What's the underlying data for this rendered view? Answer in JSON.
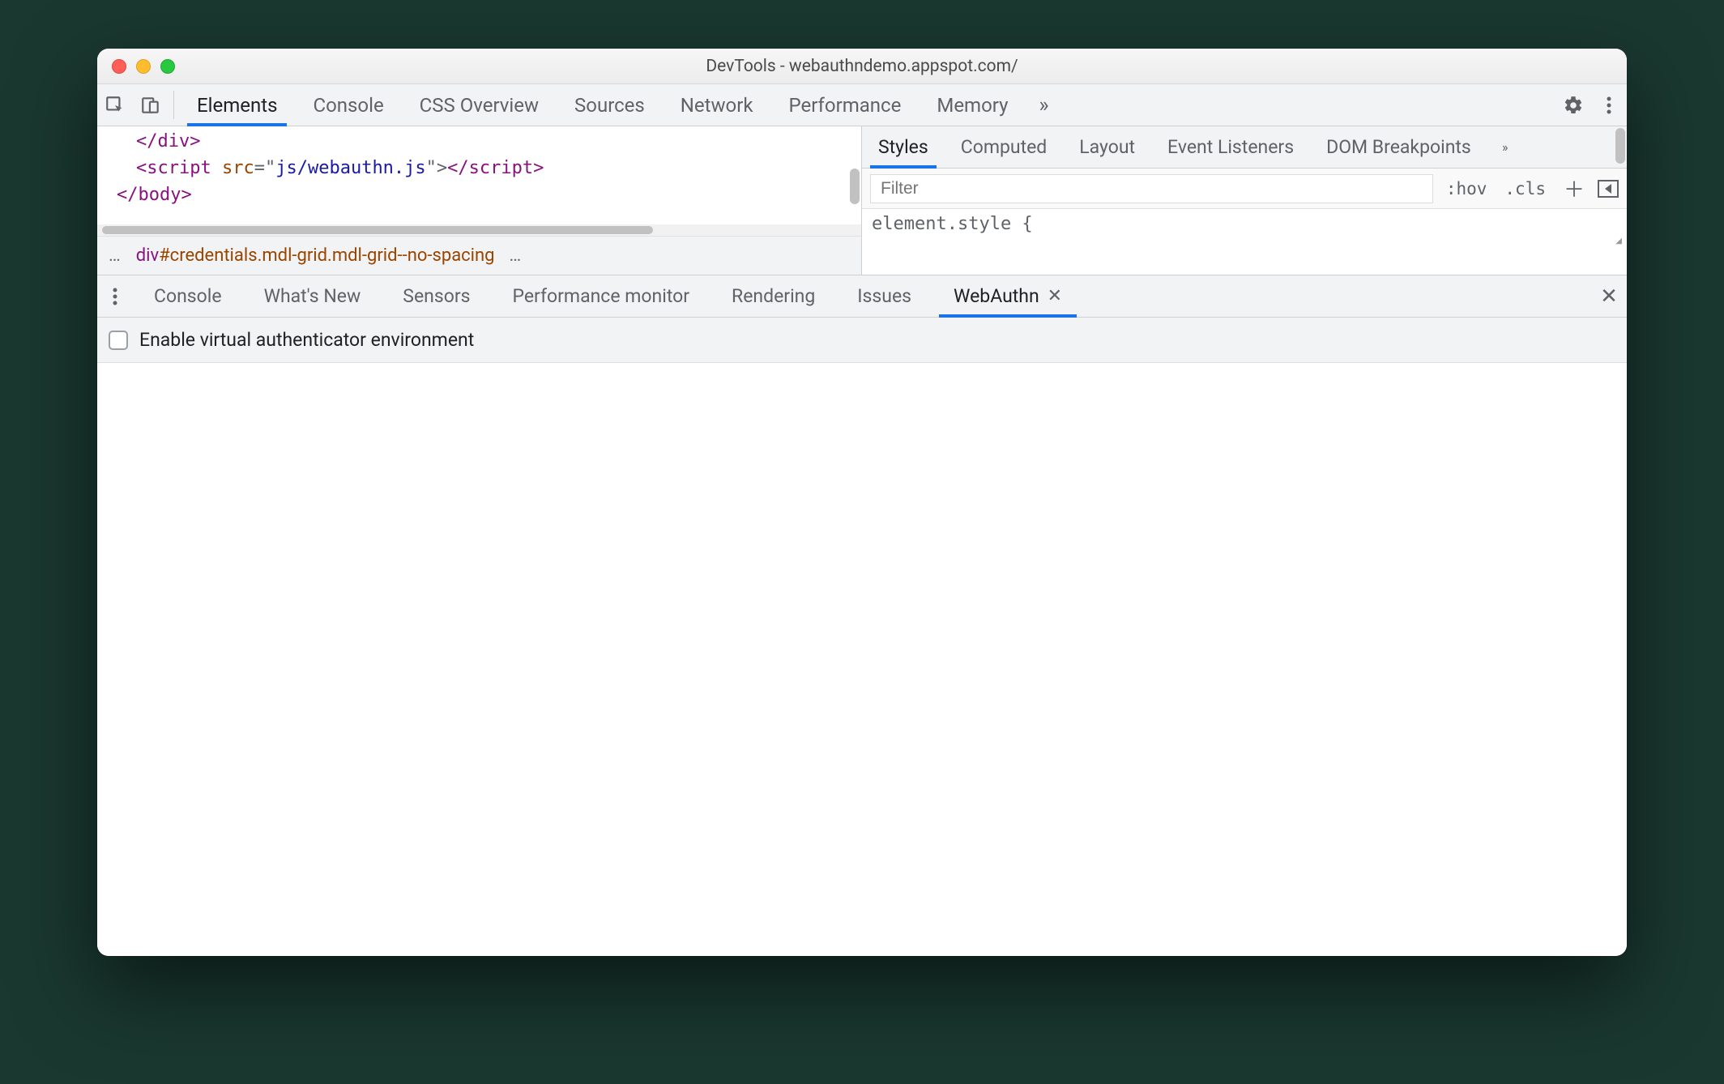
{
  "window": {
    "title": "DevTools - webauthndemo.appspot.com/"
  },
  "mainTabs": {
    "items": [
      "Elements",
      "Console",
      "CSS Overview",
      "Sources",
      "Network",
      "Performance",
      "Memory"
    ],
    "active": 0
  },
  "elementsPanel": {
    "codeLines": {
      "l1a": "</",
      "l1b": "div",
      "l1c": ">",
      "l2a": "<",
      "l2b": "script",
      "l2c": " ",
      "l2d": "src",
      "l2e": "=\"",
      "l2f": "js/webauthn.js",
      "l2g": "\">",
      "l2h": "</",
      "l2i": "script",
      "l2j": ">",
      "l3a": "</",
      "l3b": "body",
      "l3c": ">"
    },
    "breadcrumb": {
      "tag": "div",
      "id": "#credentials",
      "classes": ".mdl-grid.mdl-grid--no-spacing",
      "ellipsis": "…"
    }
  },
  "stylesPanel": {
    "tabs": [
      "Styles",
      "Computed",
      "Layout",
      "Event Listeners",
      "DOM Breakpoints"
    ],
    "active": 0,
    "filterPlaceholder": "Filter",
    "hov": ":hov",
    "cls": ".cls",
    "bodyText": "element.style {"
  },
  "drawer": {
    "tabs": [
      "Console",
      "What's New",
      "Sensors",
      "Performance monitor",
      "Rendering",
      "Issues",
      "WebAuthn"
    ],
    "active": 6
  },
  "webauthn": {
    "checkboxLabel": "Enable virtual authenticator environment"
  }
}
